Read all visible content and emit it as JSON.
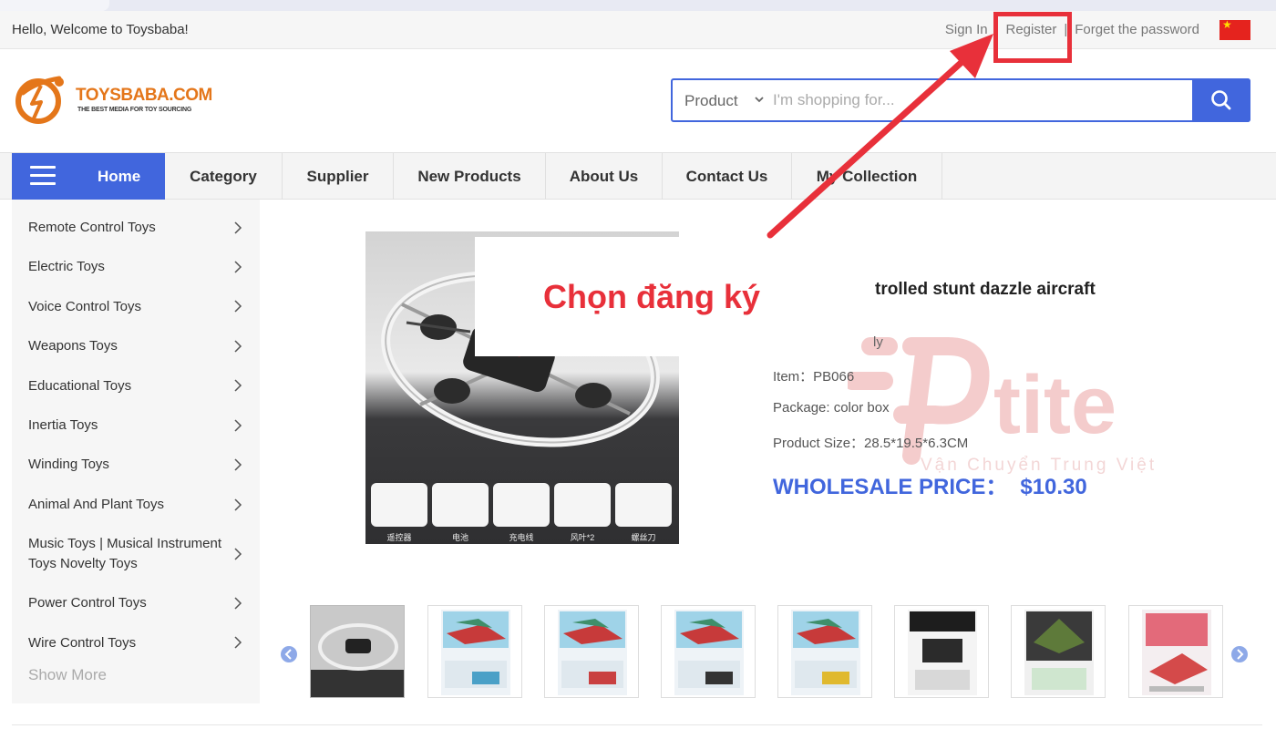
{
  "topbar": {
    "welcome": "Hello, Welcome to Toysbaba!",
    "sign_in": "Sign In",
    "register": "Register",
    "forget": "Forget the password",
    "separator": "|"
  },
  "logo": {
    "name": "TOYSBABA.COM",
    "tagline": "THE BEST MEDIA FOR TOY SOURCING"
  },
  "search": {
    "category": "Product",
    "placeholder": "I'm shopping for..."
  },
  "nav": {
    "home": "Home",
    "items": [
      "Category",
      "Supplier",
      "New Products",
      "About Us",
      "Contact Us",
      "My Collection"
    ]
  },
  "sidebar": {
    "categories": [
      "Remote Control Toys",
      "Electric Toys",
      "Voice Control Toys",
      "Weapons Toys",
      "Educational Toys",
      "Inertia Toys",
      "Winding Toys",
      "Animal And Plant Toys",
      "Music Toys | Musical Instrument",
      "Toys Novelty Toys",
      "Power Control Toys",
      "Wire Control Toys"
    ],
    "show_more": "Show More"
  },
  "product": {
    "title_fragment": "trolled stunt dazzle aircraft",
    "line_fragment": "ly",
    "item": "Item：PB066",
    "package": "Package: color box",
    "size": "Product Size：28.5*19.5*6.3CM",
    "price_label": "WHOLESALE PRICE：",
    "price_value": "$10.30",
    "accessories": [
      "遥控器",
      "电池",
      "充电线",
      "风叶*2",
      "螺丝刀"
    ]
  },
  "annotation": {
    "callout": "Chọn đăng ký",
    "color": "#e8303a"
  },
  "watermark": {
    "brand": "tite",
    "subtitle": "Vận Chuyển Trung Việt"
  },
  "colors": {
    "accent": "#4166dd",
    "logo_orange": "#e4761a",
    "annotation_red": "#e8303a"
  }
}
